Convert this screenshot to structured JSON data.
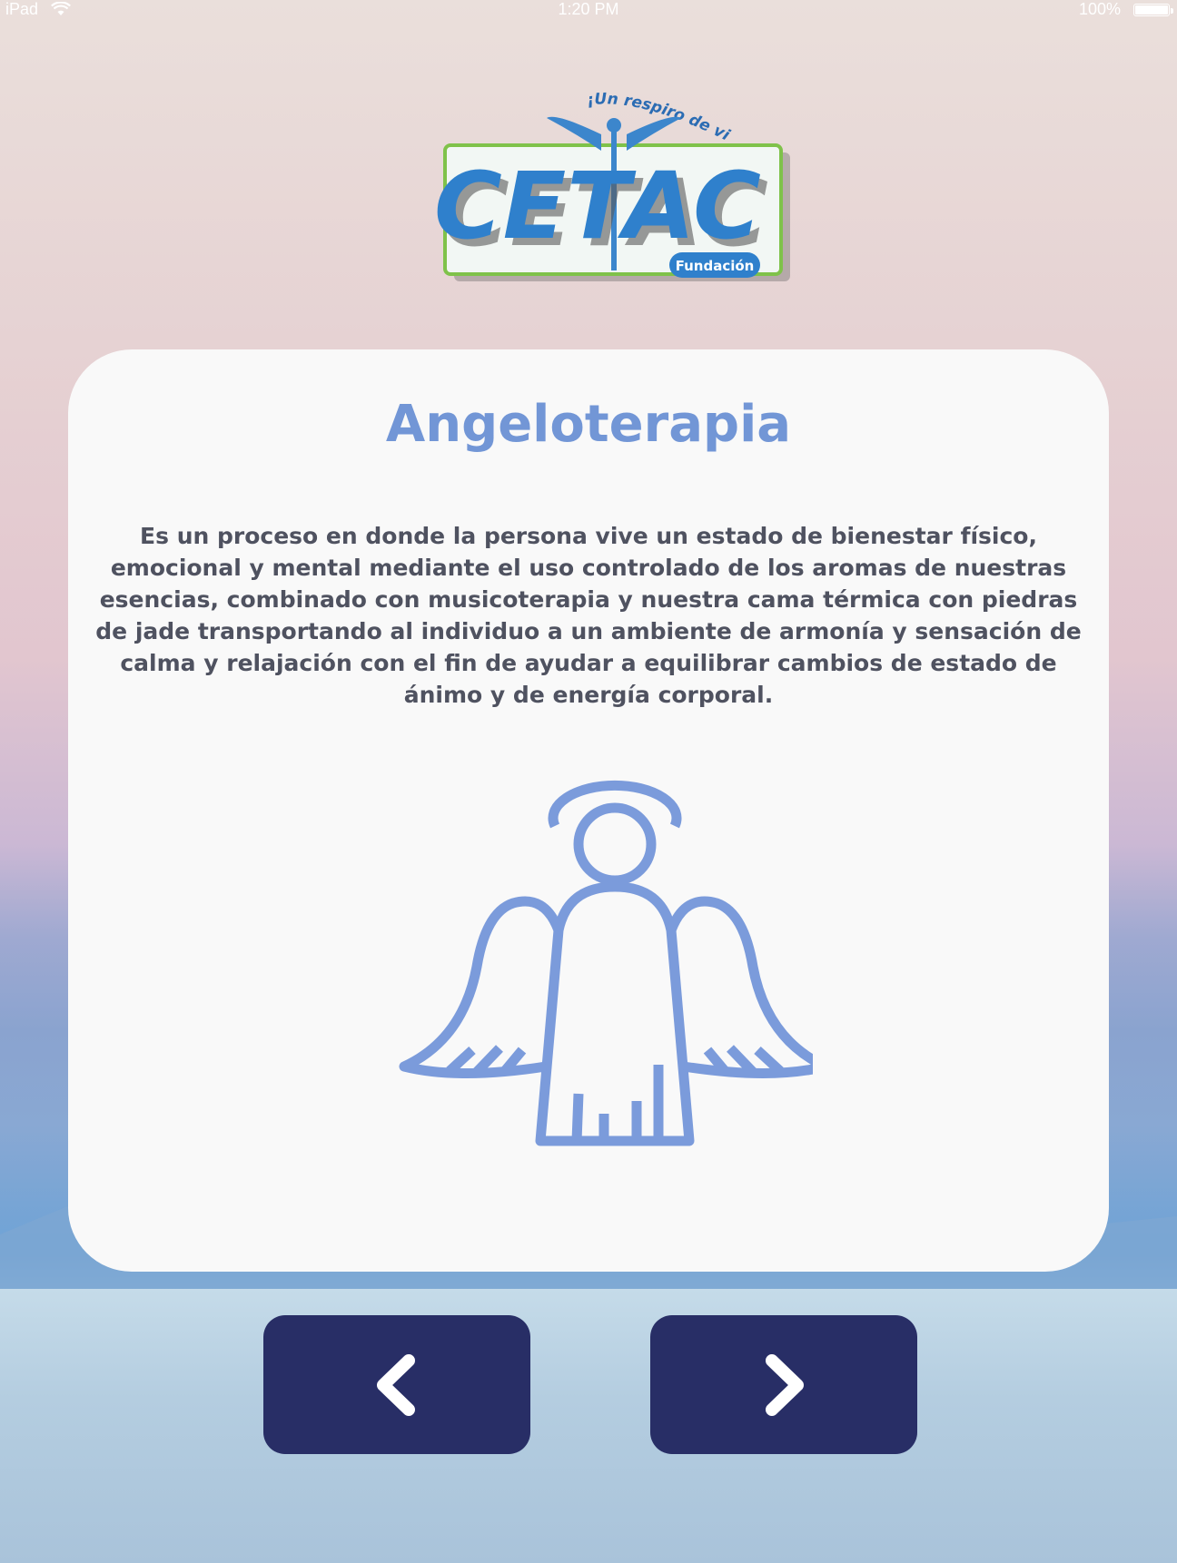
{
  "status_bar": {
    "device": "iPad",
    "time": "1:20 PM",
    "battery": "100%"
  },
  "logo": {
    "slogan": "¡Un respiro de vida!",
    "name": "CETAC",
    "badge": "Fundación"
  },
  "card": {
    "title": "Angeloterapia",
    "description": "Es un proceso en donde la persona vive un estado de bienestar físico, emocional y mental mediante el uso controlado de los aromas de nuestras esencias, combinado con musicoterapia y nuestra cama térmica con piedras de jade transportando al individuo a un ambiente de armonía y sensación de calma y relajación con el fin de ayudar a equilibrar cambios de estado de ánimo y de energía corporal.",
    "icon": "angel-icon"
  },
  "navigation": {
    "prev_icon": "chevron-left-icon",
    "next_icon": "chevron-right-icon"
  },
  "colors": {
    "title": "#7296d6",
    "text": "#4f5260",
    "card_bg": "#f9f9f9",
    "button_bg": "#282e66",
    "icon_stroke": "#7b9bdb"
  }
}
